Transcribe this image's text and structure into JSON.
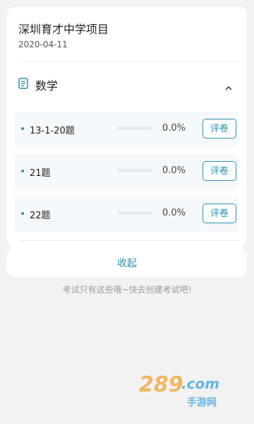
{
  "project": {
    "title": "深圳育才中学项目",
    "date": "2020-04-11"
  },
  "subject": {
    "name": "数学",
    "icon": "document-icon",
    "expanded": true
  },
  "questions": [
    {
      "label": "13-1-20题",
      "progress": 0.0,
      "percent": "0.0%",
      "button": "评卷"
    },
    {
      "label": "21题",
      "progress": 0.0,
      "percent": "0.0%",
      "button": "评卷"
    },
    {
      "label": "22题",
      "progress": 0.0,
      "percent": "0.0%",
      "button": "评卷"
    }
  ],
  "collapse_label": "收起",
  "footer_note": "考试只有这些哦~快去创建考试吧!",
  "watermark": {
    "text": "289.com",
    "sub": "手游网"
  },
  "colors": {
    "accent": "#2e8fb0",
    "background": "#f2f2f2",
    "row_bg": "#f5f9fc"
  }
}
